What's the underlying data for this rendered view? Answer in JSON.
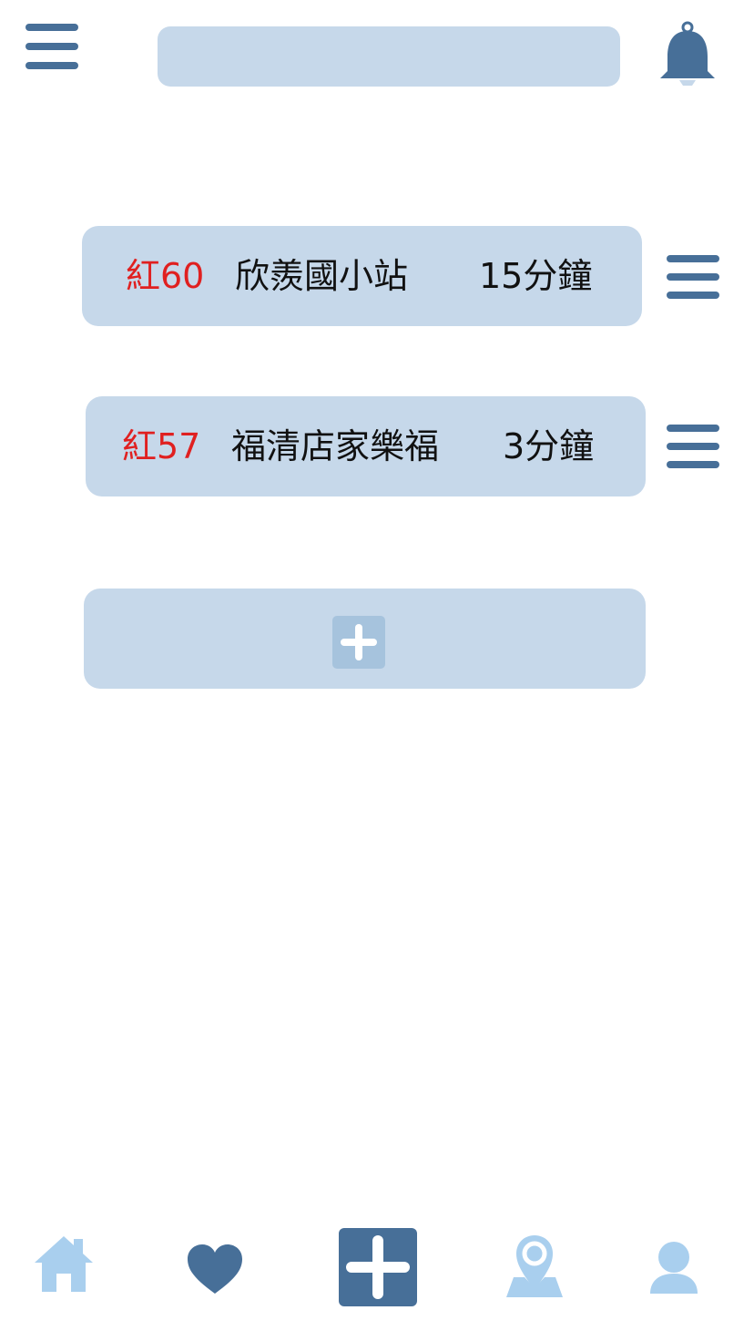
{
  "header": {
    "menu_icon": "hamburger-menu-icon",
    "search": {
      "value": "",
      "placeholder": ""
    },
    "notification_icon": "bell-icon"
  },
  "routes": [
    {
      "route": "紅60",
      "stop": "欣羨國小站",
      "eta": "15分鐘"
    },
    {
      "route": "紅57",
      "stop": "福清店家樂福",
      "eta": "3分鐘"
    }
  ],
  "add_route": {
    "icon": "plus-icon"
  },
  "bottom_nav": [
    {
      "name": "home",
      "icon": "home-icon"
    },
    {
      "name": "favorites",
      "icon": "heart-icon"
    },
    {
      "name": "add",
      "icon": "plus-icon"
    },
    {
      "name": "map",
      "icon": "map-pin-icon"
    },
    {
      "name": "profile",
      "icon": "user-icon"
    }
  ],
  "colors": {
    "primary": "#476f98",
    "card": "#c6d8ea",
    "light_icon": "#a9cfee",
    "route_red": "#e02020"
  }
}
